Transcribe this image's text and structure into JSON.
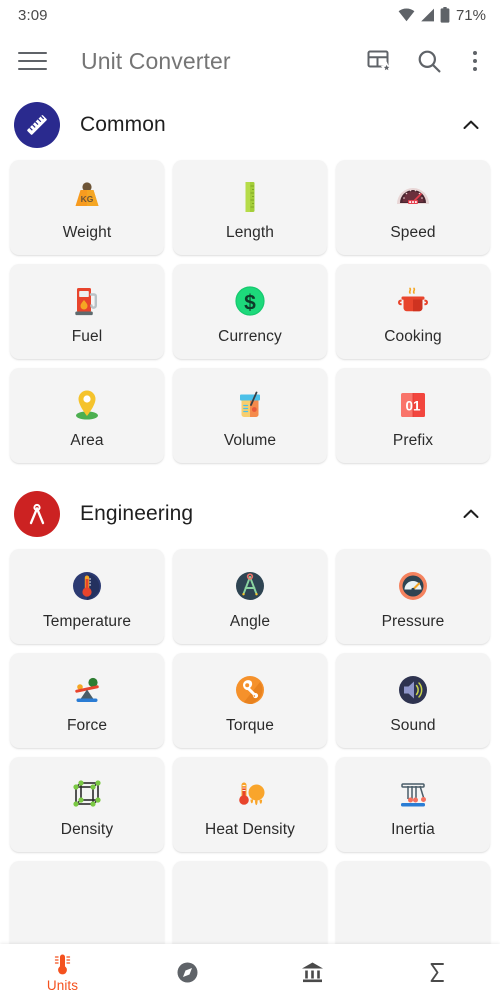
{
  "status_bar": {
    "time": "3:09",
    "battery_percent": "71%",
    "icons": [
      "wifi-icon",
      "signal-icon",
      "battery-icon"
    ]
  },
  "app_bar": {
    "menu_icon": "hamburger-menu-icon",
    "title": "Unit Converter",
    "actions": [
      {
        "name": "favorites-grid-icon",
        "label": "Favorites"
      },
      {
        "name": "search-icon",
        "label": "Search"
      },
      {
        "name": "overflow-menu-icon",
        "label": "More options"
      }
    ]
  },
  "sections": [
    {
      "id": "common",
      "title": "Common",
      "badge_icon": "ruler-icon",
      "badge_color": "#2A2A8E",
      "expanded": true,
      "chevron": "chevron-up-icon",
      "cards": [
        {
          "label": "Weight",
          "icon": "weight-kg-icon"
        },
        {
          "label": "Length",
          "icon": "ruler-green-icon"
        },
        {
          "label": "Speed",
          "icon": "speedometer-icon"
        },
        {
          "label": "Fuel",
          "icon": "fuel-pump-icon"
        },
        {
          "label": "Currency",
          "icon": "dollar-coin-icon"
        },
        {
          "label": "Cooking",
          "icon": "cooking-pot-icon"
        },
        {
          "label": "Area",
          "icon": "map-pin-icon"
        },
        {
          "label": "Volume",
          "icon": "beaker-icon"
        },
        {
          "label": "Prefix",
          "icon": "flip-card-01-icon"
        }
      ]
    },
    {
      "id": "engineering",
      "title": "Engineering",
      "badge_icon": "compass-divider-icon",
      "badge_color": "#CC2222",
      "expanded": true,
      "chevron": "chevron-up-icon",
      "cards": [
        {
          "label": "Temperature",
          "icon": "thermometer-icon"
        },
        {
          "label": "Angle",
          "icon": "protractor-compass-icon"
        },
        {
          "label": "Pressure",
          "icon": "pressure-gauge-icon"
        },
        {
          "label": "Force",
          "icon": "seesaw-balance-icon"
        },
        {
          "label": "Torque",
          "icon": "wrench-gear-icon"
        },
        {
          "label": "Sound",
          "icon": "speaker-sound-icon"
        },
        {
          "label": "Density",
          "icon": "lattice-cube-icon"
        },
        {
          "label": "Heat Density",
          "icon": "heat-density-icon"
        },
        {
          "label": "Inertia",
          "icon": "newtons-cradle-icon"
        }
      ]
    }
  ],
  "bottom_nav": {
    "active_index": 0,
    "items": [
      {
        "label": "Units",
        "icon": "thermometer-units-icon",
        "active": true
      },
      {
        "label": "",
        "icon": "compass-icon",
        "active": false
      },
      {
        "label": "",
        "icon": "bank-icon",
        "active": false
      },
      {
        "label": "",
        "icon": "sigma-icon",
        "active": false
      }
    ]
  },
  "colors": {
    "accent": "#F4511E",
    "card_bg": "#F4F4F4",
    "page_bg": "#FFFFFF",
    "title_gray": "#757575"
  }
}
